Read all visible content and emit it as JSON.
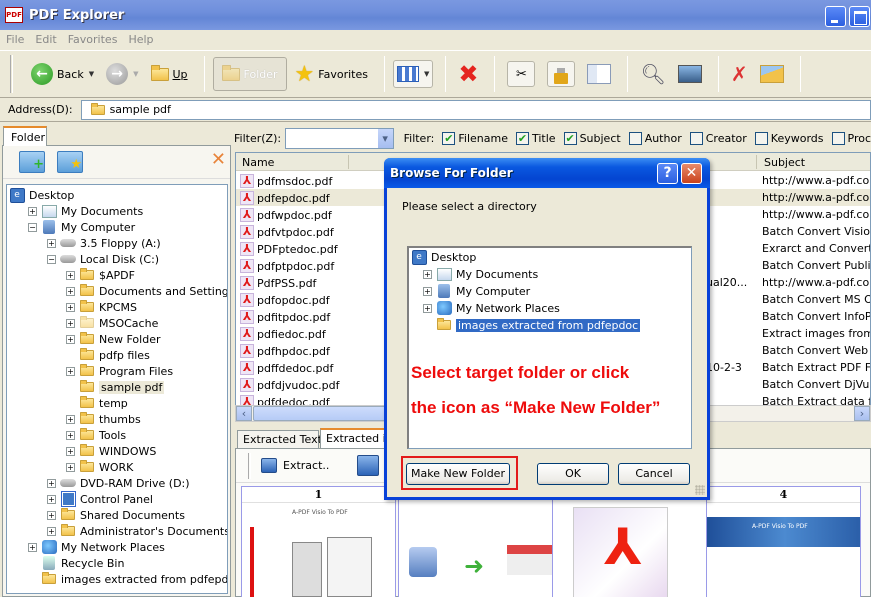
{
  "window": {
    "title": "PDF Explorer",
    "app_icon": "pdf-app-icon",
    "controls": [
      "minimize",
      "maximize"
    ]
  },
  "menu": [
    "File",
    "Edit",
    "Favorites",
    "Help"
  ],
  "toolbar": {
    "back_label": "Back",
    "up_label": "Up",
    "folder_label": "Folder",
    "favorites_label": "Favorites",
    "icons": [
      "view-mode-icon",
      "delete-icon",
      "properties-icon",
      "lock-icon",
      "columns-icon",
      "search-icon",
      "image-search-icon",
      "tools-icon",
      "email-icon"
    ]
  },
  "address": {
    "label": "Address(D):",
    "value": "sample pdf"
  },
  "left_panel": {
    "tab": "Folder",
    "tree": [
      {
        "label": "Desktop",
        "level": 0,
        "icon": "desktop",
        "toggle": ""
      },
      {
        "label": "My Documents",
        "level": 1,
        "icon": "docs",
        "toggle": "+"
      },
      {
        "label": "My Computer",
        "level": 1,
        "icon": "computer",
        "toggle": "-"
      },
      {
        "label": "3.5 Floppy (A:)",
        "level": 2,
        "icon": "drive",
        "toggle": "+"
      },
      {
        "label": "Local Disk (C:)",
        "level": 2,
        "icon": "drive",
        "toggle": "-"
      },
      {
        "label": "$APDF",
        "level": 3,
        "icon": "folder",
        "toggle": "+"
      },
      {
        "label": "Documents and Settings",
        "level": 3,
        "icon": "folder",
        "toggle": "+"
      },
      {
        "label": "KPCMS",
        "level": 3,
        "icon": "folder",
        "toggle": "+"
      },
      {
        "label": "MSOCache",
        "level": 3,
        "icon": "folder-pale",
        "toggle": "+"
      },
      {
        "label": "New Folder",
        "level": 3,
        "icon": "folder",
        "toggle": "+"
      },
      {
        "label": "pdfp files",
        "level": 3,
        "icon": "folder",
        "toggle": ""
      },
      {
        "label": "Program Files",
        "level": 3,
        "icon": "folder",
        "toggle": "+"
      },
      {
        "label": "sample pdf",
        "level": 3,
        "icon": "folder",
        "toggle": "",
        "selected": true
      },
      {
        "label": "temp",
        "level": 3,
        "icon": "folder",
        "toggle": ""
      },
      {
        "label": "thumbs",
        "level": 3,
        "icon": "folder",
        "toggle": "+"
      },
      {
        "label": "Tools",
        "level": 3,
        "icon": "folder",
        "toggle": "+"
      },
      {
        "label": "WINDOWS",
        "level": 3,
        "icon": "folder",
        "toggle": "+"
      },
      {
        "label": "WORK",
        "level": 3,
        "icon": "folder",
        "toggle": "+"
      },
      {
        "label": "DVD-RAM Drive (D:)",
        "level": 2,
        "icon": "drive",
        "toggle": "+"
      },
      {
        "label": "Control Panel",
        "level": 2,
        "icon": "cp",
        "toggle": "+"
      },
      {
        "label": "Shared Documents",
        "level": 2,
        "icon": "folder",
        "toggle": "+"
      },
      {
        "label": "Administrator's Documents",
        "level": 2,
        "icon": "folder",
        "toggle": "+"
      },
      {
        "label": "My Network Places",
        "level": 1,
        "icon": "net",
        "toggle": "+"
      },
      {
        "label": "Recycle Bin",
        "level": 1,
        "icon": "bin",
        "toggle": ""
      },
      {
        "label": "images extracted from pdfepdoc",
        "level": 1,
        "icon": "folder",
        "toggle": ""
      }
    ]
  },
  "filter": {
    "label": "Filter(Z):",
    "value": "",
    "fields_label": "Filter:",
    "checkboxes": [
      {
        "label": "Filename",
        "checked": true
      },
      {
        "label": "Title",
        "checked": true
      },
      {
        "label": "Subject",
        "checked": true
      },
      {
        "label": "Author",
        "checked": false
      },
      {
        "label": "Creator",
        "checked": false
      },
      {
        "label": "Keywords",
        "checked": false
      },
      {
        "label": "Proc",
        "checked": false
      }
    ]
  },
  "file_list": {
    "columns": [
      "Name",
      "Subject"
    ],
    "rows": [
      {
        "name": "pdfmsdoc.pdf",
        "mid": "",
        "subject": "http://www.a-pdf.com"
      },
      {
        "name": "pdfepdoc.pdf",
        "mid": "",
        "subject": "http://www.a-pdf.com",
        "selected": true
      },
      {
        "name": "pdfwpdoc.pdf",
        "mid": "",
        "subject": "http://www.a-pdf.com"
      },
      {
        "name": "pdfvtpdoc.pdf",
        "mid": "",
        "subject": "Batch Convert  Visio To"
      },
      {
        "name": "PDFptedoc.pdf",
        "mid": "",
        "subject": "Exrarct and Convert PD"
      },
      {
        "name": "pdfptpdoc.pdf",
        "mid": "",
        "subject": "Batch Convert Publishe"
      },
      {
        "name": "PdfPSS.pdf",
        "mid": "ual20...",
        "subject": "http://www.a-pdf.com"
      },
      {
        "name": "pdfopdoc.pdf",
        "mid": "",
        "subject": "Batch Convert  MS Offi"
      },
      {
        "name": "pdfitpdoc.pdf",
        "mid": "",
        "subject": "Batch Convert InfoPatl"
      },
      {
        "name": "pdfiedoc.pdf",
        "mid": "",
        "subject": "Extract images from Ac"
      },
      {
        "name": "pdfhpdoc.pdf",
        "mid": "",
        "subject": "Batch Convert Web Pa"
      },
      {
        "name": "pdffdedoc.pdf",
        "mid": "10-2-3",
        "subject": "Batch Extract PDF Forr"
      },
      {
        "name": "pdfdjvudoc.pdf",
        "mid": "",
        "subject": "Batch Convert  DjVu To"
      },
      {
        "name": "pdfdedoc.pdf",
        "mid": "",
        "subject": "Batch Extract data fror"
      }
    ]
  },
  "bottom": {
    "tabs": [
      "Extracted Text",
      "Extracted im"
    ],
    "active_tab": 1,
    "extract_label": "Extract..",
    "thumbnails": [
      {
        "number": "1",
        "caption": "A-PDF Visio To PDF"
      },
      {
        "number": "",
        "caption": ""
      },
      {
        "number": "",
        "caption": ""
      },
      {
        "number": "4",
        "caption": "A-PDF Visio To PDF"
      }
    ]
  },
  "dialog": {
    "title": "Browse For Folder",
    "prompt": "Please select a directory",
    "tree": [
      {
        "label": "Desktop",
        "level": 0,
        "icon": "desktop",
        "toggle": ""
      },
      {
        "label": "My Documents",
        "level": 1,
        "icon": "docs",
        "toggle": "+"
      },
      {
        "label": "My Computer",
        "level": 1,
        "icon": "computer",
        "toggle": "+"
      },
      {
        "label": "My Network Places",
        "level": 1,
        "icon": "net",
        "toggle": "+"
      },
      {
        "label": "images extracted from pdfepdoc",
        "level": 1,
        "icon": "folder",
        "toggle": "",
        "selected": true
      }
    ],
    "annotation_line1": "Select target folder or click",
    "annotation_line2": "the icon as “Make New Folder”",
    "make_new_folder_label": "Make New Folder",
    "ok_label": "OK",
    "cancel_label": "Cancel",
    "highlight_color": "#e31b1b"
  }
}
